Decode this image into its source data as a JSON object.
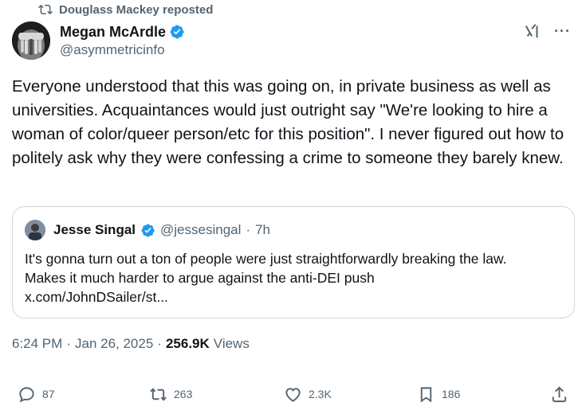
{
  "repost": {
    "label": "Douglass Mackey reposted",
    "icon": "repost-icon"
  },
  "author": {
    "name": "Megan McArdle",
    "handle": "@asymmetricinfo",
    "verified": true
  },
  "tweet": {
    "text": "Everyone understood that this was going on, in private business as well as universities. Acquaintances would just outright say \"We're looking to hire a woman of color/queer person/etc for this position\". I never figured out how to politely ask why they were confessing a crime to someone they barely knew."
  },
  "quote": {
    "name": "Jesse Singal",
    "handle": "@jessesingal",
    "separator": "·",
    "time": "7h",
    "text_lines": [
      "It's gonna turn out a ton of people were just straightforwardly breaking the law.",
      "Makes it much harder to argue against the anti-DEI push",
      "x.com/JohnDSailer/st..."
    ]
  },
  "meta": {
    "time": "6:24 PM",
    "separator": "·",
    "date": "Jan 26, 2025",
    "separator2": "·",
    "views_count": "256.9K",
    "views_label": "Views"
  },
  "actions": {
    "replies": "87",
    "reposts": "263",
    "likes": "2.3K",
    "bookmarks": "186"
  },
  "colors": {
    "verified": "#1d9bf0",
    "secondary_text": "#536471",
    "border": "#cfd9de"
  }
}
